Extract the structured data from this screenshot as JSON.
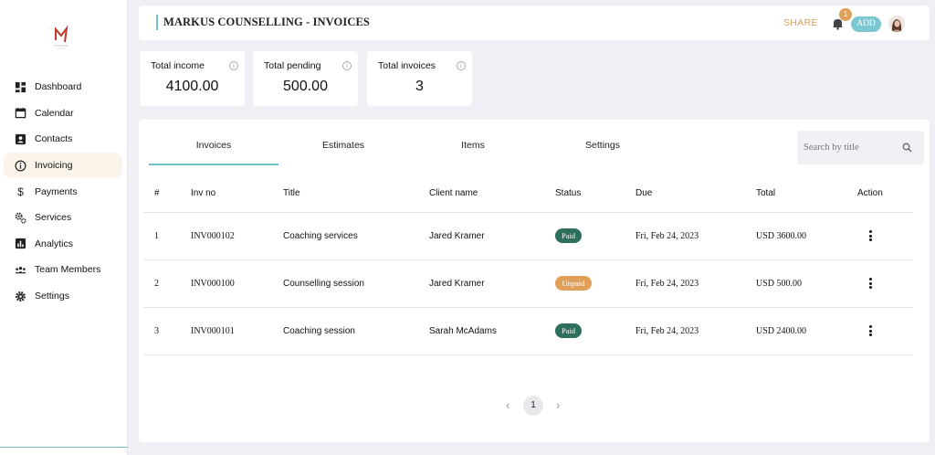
{
  "sidebar": {
    "items": [
      {
        "label": "Dashboard",
        "icon": "dashboard-icon"
      },
      {
        "label": "Calendar",
        "icon": "calendar-icon"
      },
      {
        "label": "Contacts",
        "icon": "contacts-icon"
      },
      {
        "label": "Invoicing",
        "icon": "info-icon",
        "active": true
      },
      {
        "label": "Payments",
        "icon": "dollar-icon"
      },
      {
        "label": "Services",
        "icon": "gears-icon"
      },
      {
        "label": "Analytics",
        "icon": "analytics-icon"
      },
      {
        "label": "Team Members",
        "icon": "team-icon"
      },
      {
        "label": "Settings",
        "icon": "gear-icon"
      }
    ]
  },
  "header": {
    "title": "MARKUS COUNSELLING - INVOICES",
    "share_label": "SHARE",
    "notification_count": "1",
    "add_label": "ADD"
  },
  "stats": [
    {
      "label": "Total income",
      "value": "4100.00"
    },
    {
      "label": "Total pending",
      "value": "500.00"
    },
    {
      "label": "Total invoices",
      "value": "3"
    }
  ],
  "tabs": [
    "Invoices",
    "Estimates",
    "Items",
    "Settings"
  ],
  "active_tab": "Invoices",
  "search": {
    "placeholder": "Search by title"
  },
  "table": {
    "headers": [
      "#",
      "Inv no",
      "Title",
      "Client name",
      "Status",
      "Due",
      "Total",
      "Action"
    ],
    "rows": [
      {
        "num": "1",
        "inv_no": "INV000102",
        "title": "Coaching services",
        "client": "Jared Kramer",
        "status": "Paid",
        "due": "Fri, Feb 24, 2023",
        "total": "USD 3600.00"
      },
      {
        "num": "2",
        "inv_no": "INV000100",
        "title": "Counselling session",
        "client": "Jared Kramer",
        "status": "Unpaid",
        "due": "Fri, Feb 24, 2023",
        "total": "USD 500.00"
      },
      {
        "num": "3",
        "inv_no": "INV000101",
        "title": "Coaching session",
        "client": "Sarah McAdams",
        "status": "Paid",
        "due": "Fri, Feb 24, 2023",
        "total": "USD 2400.00"
      }
    ]
  },
  "pagination": {
    "current_page": "1",
    "prev": "‹",
    "next": "›"
  },
  "colors": {
    "accent": "#6cc3c8",
    "paid": "#2f6f5e",
    "unpaid": "#e0a05a",
    "share": "#e0a05a"
  }
}
